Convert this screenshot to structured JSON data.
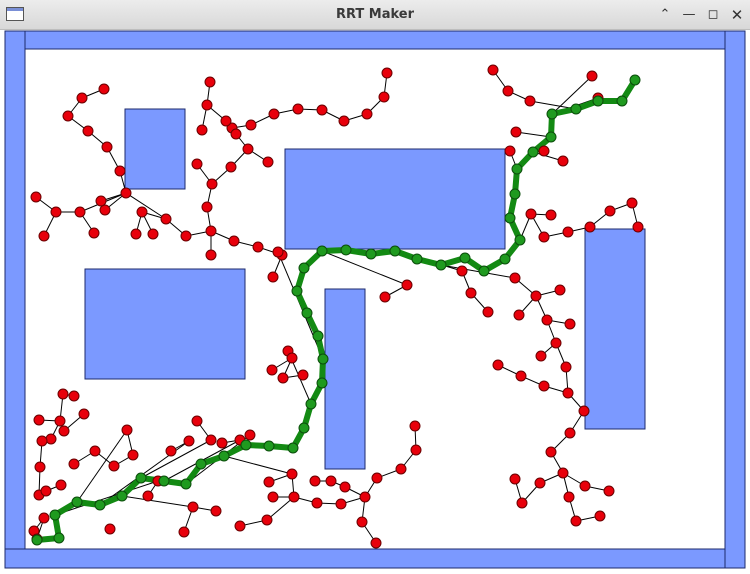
{
  "window": {
    "title": "RRT Maker",
    "controls": [
      "collapse",
      "minimize",
      "maximize",
      "close"
    ]
  },
  "colors": {
    "wall": "#7b99ff",
    "obstacle": "#7b99ff",
    "tree_node": "#e8000b",
    "tree_edge": "#000000",
    "path": "#138a13",
    "path_node": "#1f9a1f",
    "background": "#ffffff"
  },
  "map": {
    "walls": 4,
    "obstacles": 5,
    "path_waypoints": 38
  }
}
